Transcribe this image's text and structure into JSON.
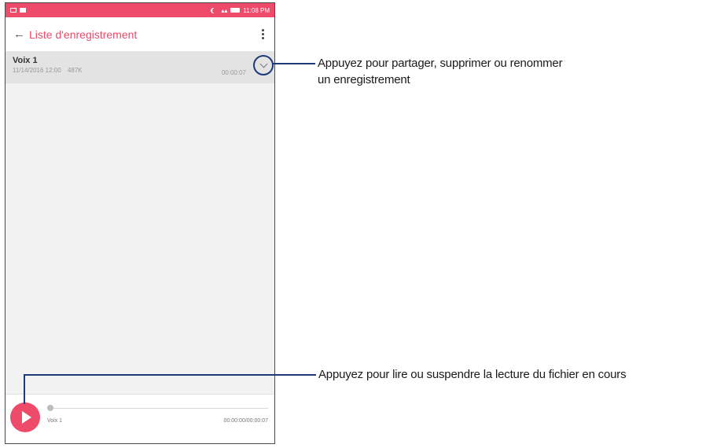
{
  "statusbar": {
    "time": "11:08 PM"
  },
  "appbar": {
    "title": "Liste d'enregistrement",
    "back_icon": "arrow-left-icon",
    "menu_icon": "more-vertical-icon"
  },
  "recordings": [
    {
      "name": "Voix 1",
      "date": "11/14/2016 12:00",
      "size": "487K",
      "duration": "00:00:07"
    }
  ],
  "player": {
    "name": "Voix 1",
    "time": "00:00:00/00:00:07",
    "play_icon": "play-icon"
  },
  "callouts": {
    "expand_line1": "Appuyez pour partager, supprimer ou renommer",
    "expand_line2": "un enregistrement",
    "play": "Appuyez pour lire ou suspendre la lecture du fichier en cours"
  },
  "colors": {
    "accent": "#ee4b6a",
    "callout": "#1d3a7a"
  }
}
